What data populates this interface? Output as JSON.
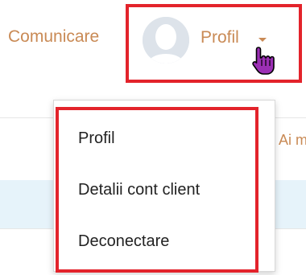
{
  "nav": {
    "comunicare": "Comunicare",
    "profile_label": "Profil",
    "partial_text": "Ai m"
  },
  "icons": {
    "avatar": "user-avatar-placeholder",
    "caret": "caret-down-icon",
    "cursor": "hand-pointer-cursor"
  },
  "dropdown": {
    "items": [
      {
        "label": "Profil"
      },
      {
        "label": "Detalii cont client"
      },
      {
        "label": "Deconectare"
      }
    ]
  },
  "colors": {
    "link": "#c98a55",
    "highlight": "#e3232b",
    "menu_text": "#222222",
    "band": "#e6f3fa"
  }
}
